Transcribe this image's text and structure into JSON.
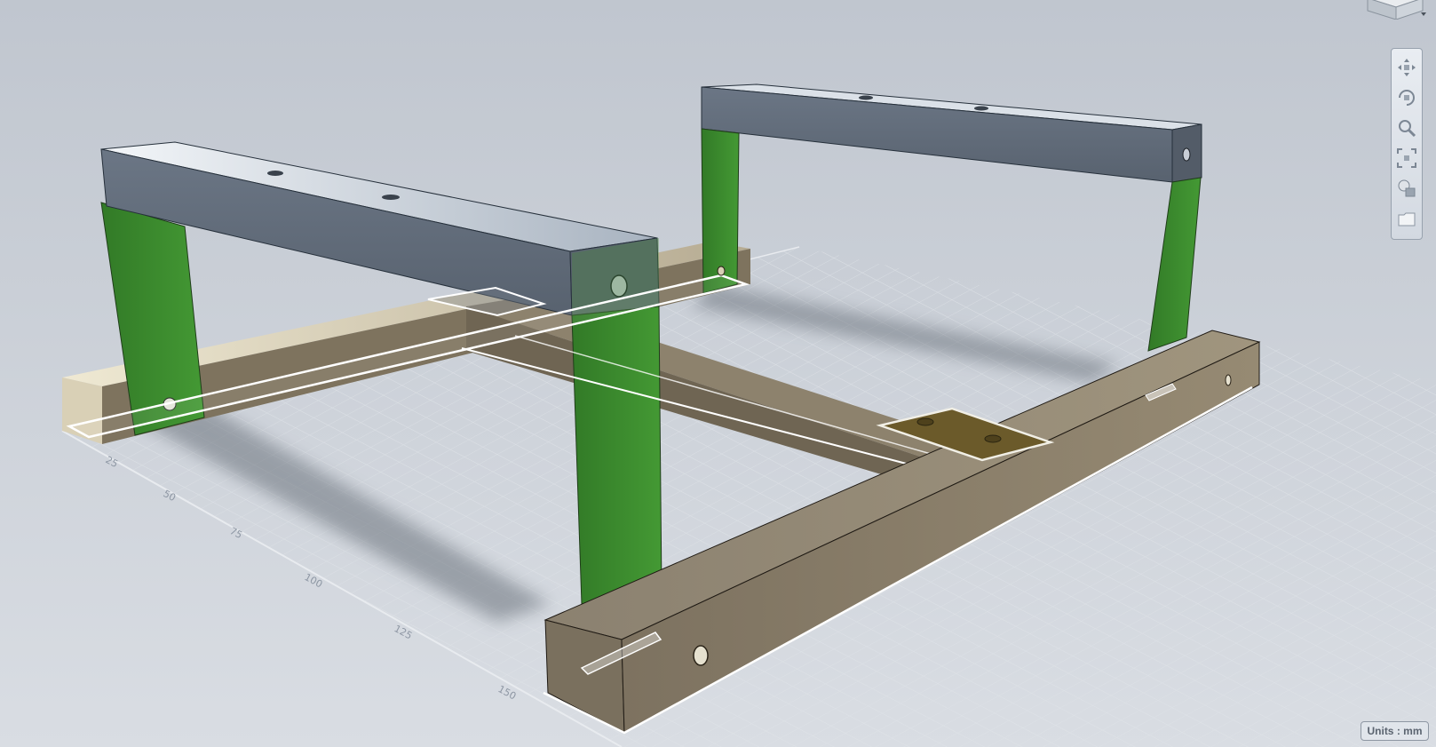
{
  "viewport": {
    "units_label": "Units : mm",
    "background_color": "#c3c9d2",
    "grid_ticks": [
      "25",
      "50",
      "75",
      "100",
      "125",
      "150"
    ]
  },
  "model": {
    "leg_color": "#3c8a2f",
    "crossbar_color": "#5d6876",
    "base_rail_color": "#8a7d68",
    "plate_color": "#6b5a2a"
  },
  "nav_bar": {
    "tools": [
      "pan-icon",
      "orbit-icon",
      "zoom-icon",
      "fit-all-icon",
      "look-at-icon",
      "views-icon"
    ]
  },
  "view_cube": {
    "icon": "viewcube-icon"
  }
}
